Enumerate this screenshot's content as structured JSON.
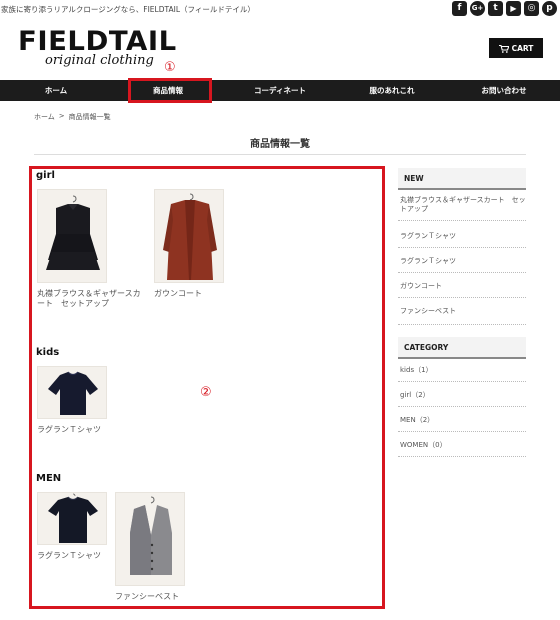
{
  "header": {
    "tagline": "家族に寄り添うリアルクロージングなら、FIELDTAIL（フィールドテイル）",
    "logo_main": "FIELDTAIL",
    "logo_sub": "original clothing",
    "cart_label": "CART",
    "social": [
      {
        "icon": "facebook-icon",
        "glyph": "f"
      },
      {
        "icon": "google-plus-icon",
        "glyph": "G+"
      },
      {
        "icon": "twitter-icon",
        "glyph": "t"
      },
      {
        "icon": "youtube-icon",
        "glyph": "▶"
      },
      {
        "icon": "instagram-icon",
        "glyph": "◎"
      },
      {
        "icon": "pinterest-icon",
        "glyph": "p"
      }
    ]
  },
  "nav": {
    "items": [
      "ホーム",
      "商品情報",
      "コーディネート",
      "服のあれこれ",
      "お問い合わせ"
    ],
    "active_index": 1
  },
  "breadcrumb": {
    "home": "ホーム",
    "separator": ">",
    "current": "商品情報一覧"
  },
  "page_title": "商品情報一覧",
  "annotations": {
    "nav_marker": "①",
    "content_marker": "②",
    "highlight_color": "#d7161f"
  },
  "sections": [
    {
      "title": "girl",
      "products": [
        {
          "name": "丸襟ブラウス＆ギャザースカート　セットアップ",
          "image": "black-dress-on-hanger"
        },
        {
          "name": "ガウンコート",
          "image": "rust-gown-coat-on-hanger"
        }
      ]
    },
    {
      "title": "kids",
      "products": [
        {
          "name": "ラグランＴシャツ",
          "image": "navy-raglan-tshirt"
        }
      ]
    },
    {
      "title": "MEN",
      "products": [
        {
          "name": "ラグランＴシャツ",
          "image": "navy-tshirt-on-hanger"
        },
        {
          "name": "ファンシーベスト",
          "image": "grey-tweed-vest-on-hanger"
        }
      ]
    }
  ],
  "sidebar": {
    "new_heading": "NEW",
    "new_items": [
      "丸襟ブラウス＆ギャザースカート　セットアップ",
      "ラグランＴシャツ",
      "ラグランＴシャツ",
      "ガウンコート",
      "ファンシーベスト"
    ],
    "category_heading": "CATEGORY",
    "categories": [
      "kids（1）",
      "girl（2）",
      "MEN（2）",
      "WOMEN（0）"
    ]
  }
}
